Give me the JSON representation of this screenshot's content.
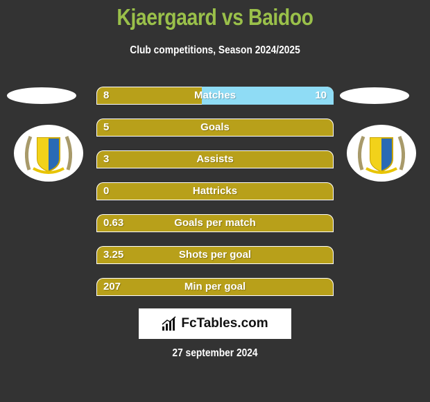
{
  "header": {
    "title": "Kjaergaard vs Baidoo",
    "subtitle": "Club competitions, Season 2024/2025"
  },
  "colors": {
    "title": "#9ac04a",
    "bar_left": "#b8a01a",
    "bar_right": "#8fdcf5",
    "background": "#333333"
  },
  "players": {
    "left": {
      "logo_icon": "club-crest-icon"
    },
    "right": {
      "logo_icon": "club-crest-icon"
    }
  },
  "stats": [
    {
      "label": "Matches",
      "left": "8",
      "right": "10",
      "right_share": 0.556
    },
    {
      "label": "Goals",
      "left": "5",
      "right": "",
      "right_share": 0
    },
    {
      "label": "Assists",
      "left": "3",
      "right": "",
      "right_share": 0
    },
    {
      "label": "Hattricks",
      "left": "0",
      "right": "",
      "right_share": 0
    },
    {
      "label": "Goals per match",
      "left": "0.63",
      "right": "",
      "right_share": 0
    },
    {
      "label": "Shots per goal",
      "left": "3.25",
      "right": "",
      "right_share": 0
    },
    {
      "label": "Min per goal",
      "left": "207",
      "right": "",
      "right_share": 0
    }
  ],
  "brand": {
    "name": "FcTables.com",
    "icon": "bar-chart-icon"
  },
  "footer": {
    "date": "27 september 2024"
  }
}
